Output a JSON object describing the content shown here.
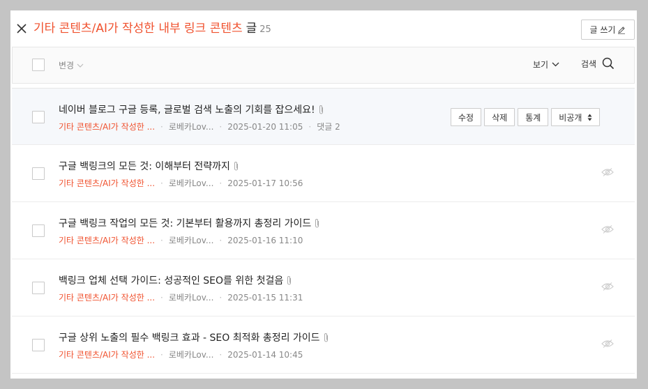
{
  "header": {
    "category": "기타 콘텐츠/AI가 작성한 내부 링크 콘텐츠",
    "suffix": "글",
    "count": "25",
    "write_button": "글 쓰기"
  },
  "toolbar": {
    "change_label": "변경",
    "view_label": "보기",
    "search_label": "검색"
  },
  "posts": [
    {
      "title": "네이버 블로그 구글 등록, 글로벌 검색 노출의 기회를 잡으세요!",
      "category": "기타 콘텐츠/AI가 작성한 ...",
      "author": "로베카Lov...",
      "date": "2025-01-20 11:05",
      "comments": "댓글 2"
    },
    {
      "title": "구글 백링크의 모든 것: 이해부터 전략까지",
      "category": "기타 콘텐츠/AI가 작성한 ...",
      "author": "로베카Lov...",
      "date": "2025-01-17 10:56"
    },
    {
      "title": "구글 백링크 작업의 모든 것: 기본부터 활용까지 총정리 가이드",
      "category": "기타 콘텐츠/AI가 작성한 ...",
      "author": "로베카Lov...",
      "date": "2025-01-16 11:10"
    },
    {
      "title": "백링크 업체 선택 가이드: 성공적인 SEO를 위한 첫걸음",
      "category": "기타 콘텐츠/AI가 작성한 ...",
      "author": "로베카Lov...",
      "date": "2025-01-15 11:31"
    },
    {
      "title": "구글 상위 노출의 필수 백링크 효과 - SEO 최적화 총정리 가이드",
      "category": "기타 콘텐츠/AI가 작성한 ...",
      "author": "로베카Lov...",
      "date": "2025-01-14 10:45"
    }
  ],
  "row_actions": {
    "edit": "수정",
    "delete": "삭제",
    "stats": "통계",
    "visibility": "비공개"
  },
  "colors": {
    "accent": "#f0512e",
    "backdrop": "#c4c4c4"
  },
  "icons": {
    "close": "close-icon",
    "pencil": "pencil-icon",
    "chevron": "chevron-down-icon",
    "search": "search-icon",
    "attachment": "paperclip-icon",
    "hidden": "eye-icon",
    "sort": "sort-arrows-icon"
  }
}
